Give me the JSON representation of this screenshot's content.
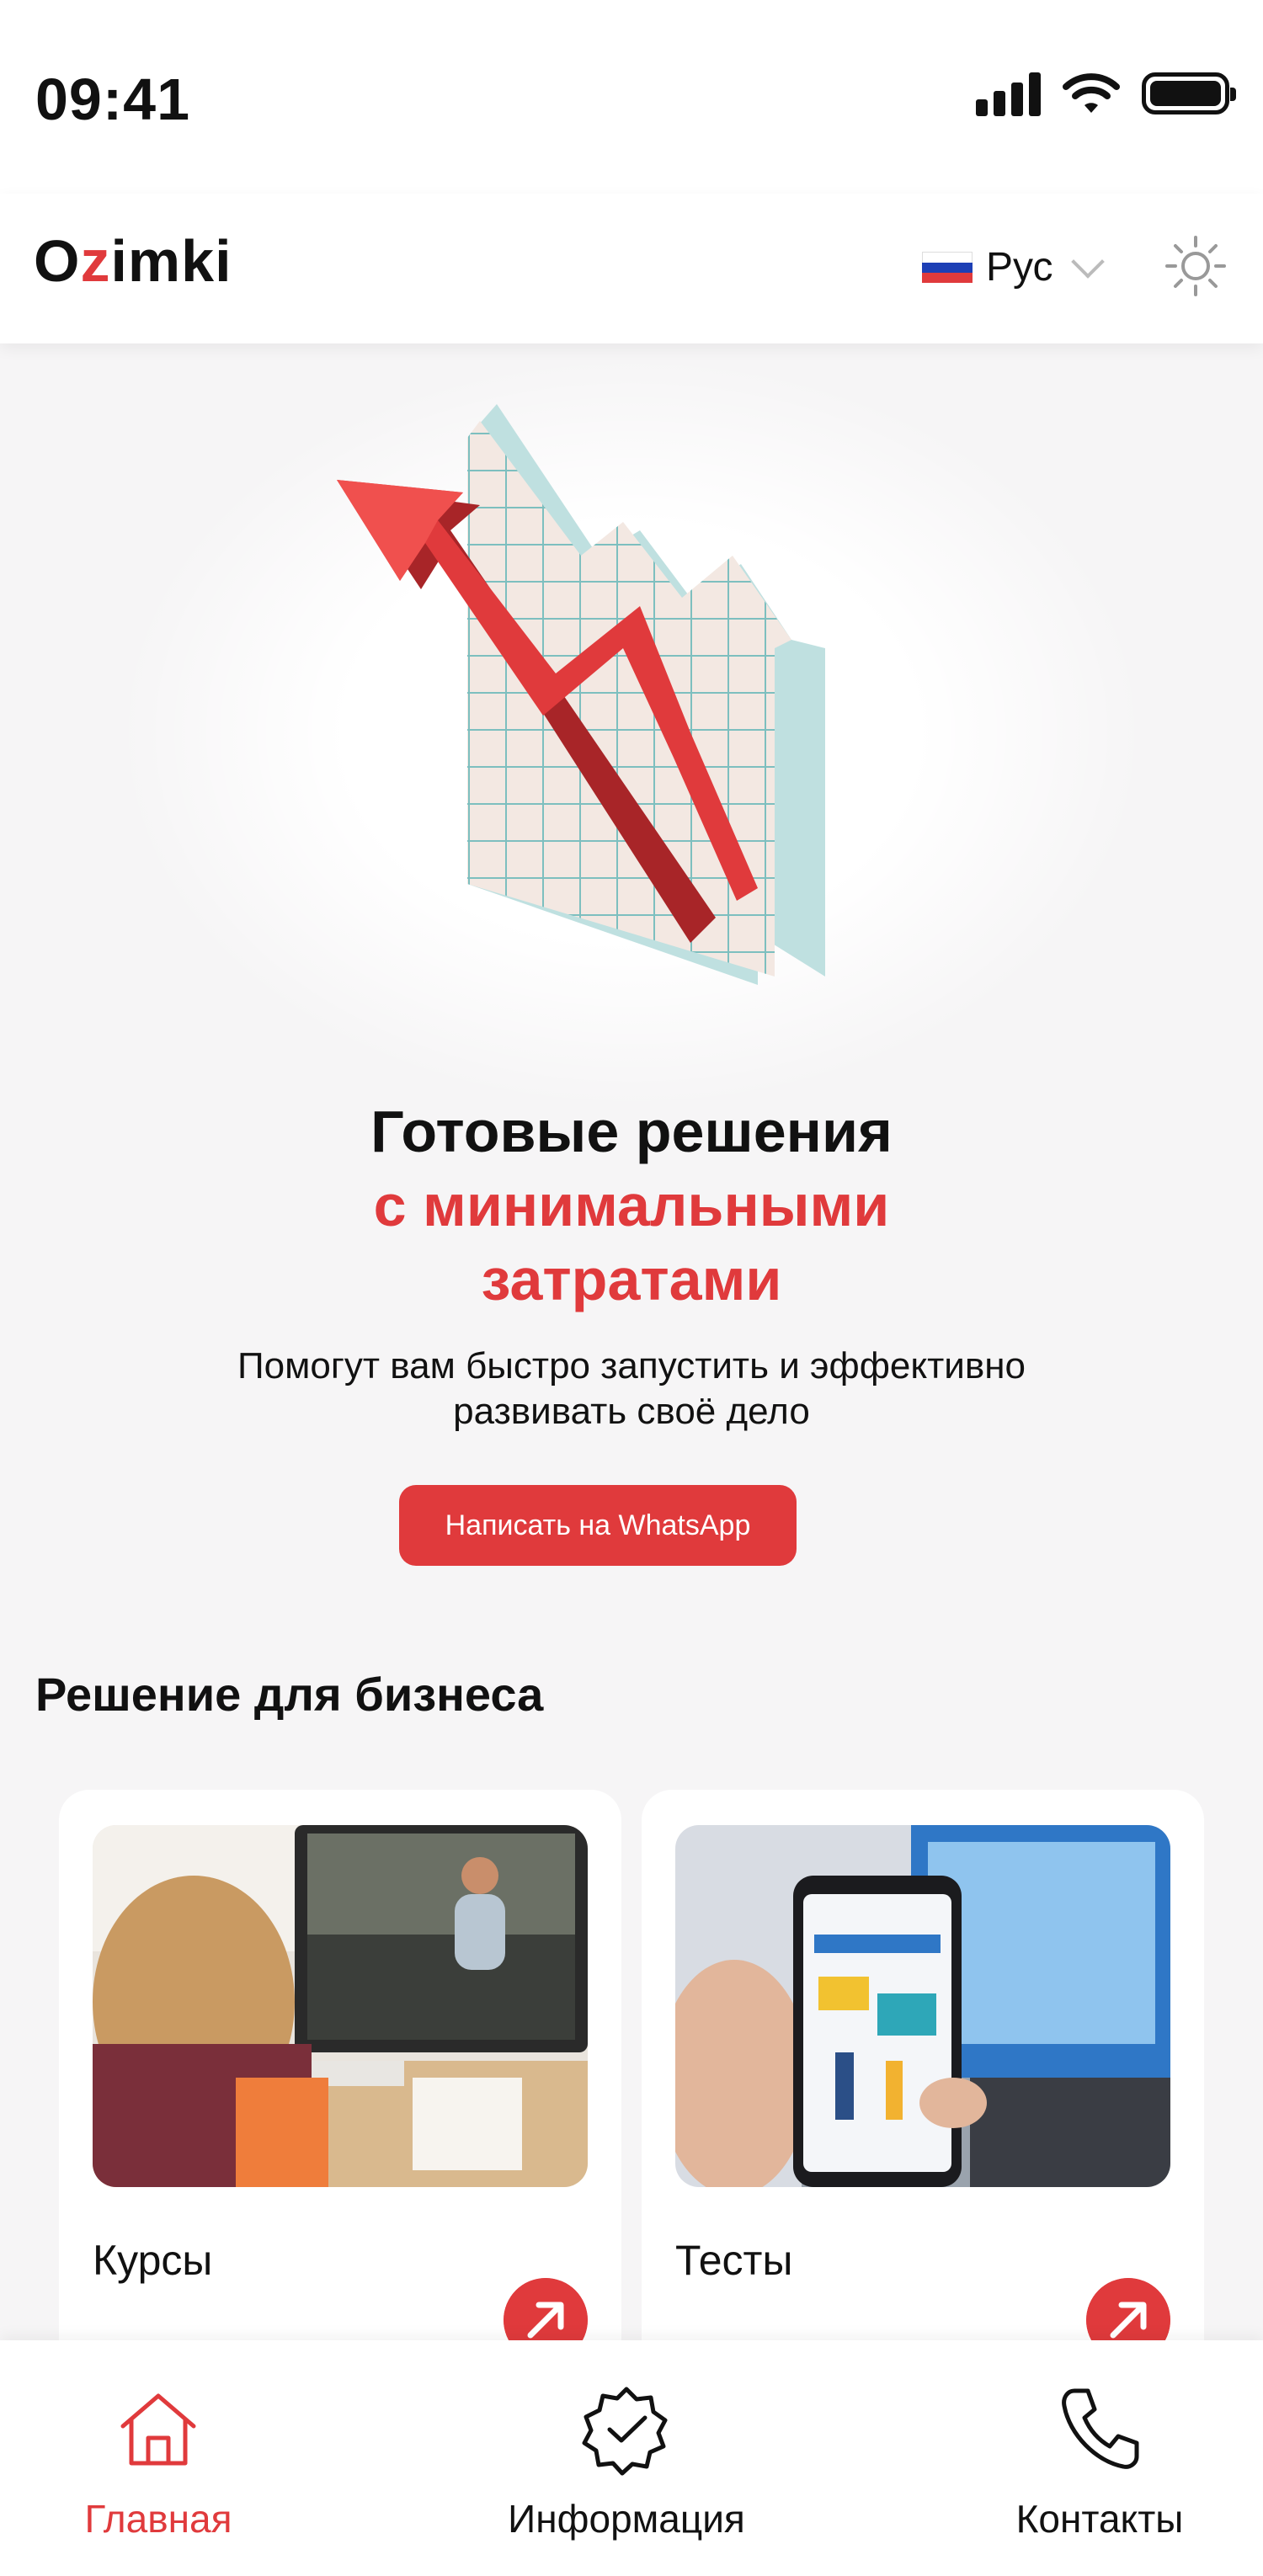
{
  "status": {
    "time": "09:41"
  },
  "header": {
    "logo": {
      "prefix": "O",
      "z": "z",
      "suffix": "imki"
    },
    "language": "Рус",
    "icons": {
      "flag": "russia-flag-icon",
      "theme": "sun-icon",
      "chevron": "chevron-down-icon"
    }
  },
  "hero": {
    "title_line1": "Готовые решения",
    "title_line2": "с минимальными",
    "title_line3": "затратами",
    "subtitle_line1": "Помогут вам быстро запустить и эффективно",
    "subtitle_line2": "развивать своё дело",
    "cta_label": "Написать на WhatsApp"
  },
  "section": {
    "title": "Решение для бизнеса",
    "cards": [
      {
        "label": "Курсы",
        "icon": "arrow-up-right-icon"
      },
      {
        "label": "Тесты",
        "icon": "arrow-up-right-icon"
      }
    ]
  },
  "tabbar": {
    "items": [
      {
        "label": "Главная",
        "icon": "home-icon",
        "active": true
      },
      {
        "label": "Информация",
        "icon": "verified-badge-icon",
        "active": false
      },
      {
        "label": "Контакты",
        "icon": "phone-icon",
        "active": false
      }
    ]
  },
  "colors": {
    "accent": "#e03a3c",
    "background": "#f6f5f6",
    "surface": "#ffffff",
    "text": "#111111"
  }
}
